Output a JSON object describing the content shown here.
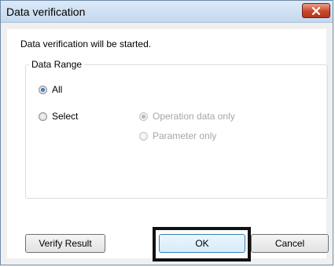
{
  "window": {
    "title": "Data verification"
  },
  "dialog": {
    "intro_text": "Data verification will be started.",
    "group_label": "Data Range",
    "options": {
      "all_label": "All",
      "select_label": "Select",
      "operation_only_label": "Operation data only",
      "parameter_only_label": "Parameter only"
    },
    "selected_option": "All"
  },
  "buttons": {
    "verify_result": "Verify Result",
    "ok": "OK",
    "cancel": "Cancel"
  },
  "colors": {
    "close_button": "#c8472a",
    "highlight_border": "#111111"
  }
}
